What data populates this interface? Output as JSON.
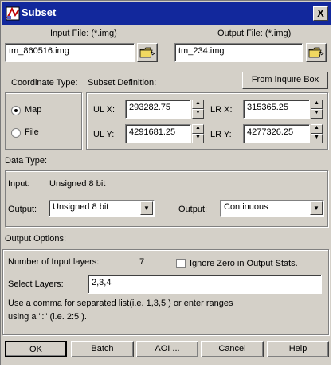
{
  "window": {
    "title": "Subset",
    "close_glyph": "X"
  },
  "files": {
    "input_label": "Input File: (*.img)",
    "input_value": "tm_860516.img",
    "output_label": "Output File: (*.img)",
    "output_value": "tm_234.img"
  },
  "coordinate": {
    "type_label": "Coordinate Type:",
    "options": [
      "Map",
      "File"
    ],
    "selected": "Map"
  },
  "subset": {
    "label": "Subset Definition:",
    "inquire_button": "From Inquire Box",
    "ulx_label": "UL X:",
    "ulx_value": "293282.75",
    "uly_label": "UL Y:",
    "uly_value": "4291681.25",
    "lrx_label": "LR X:",
    "lrx_value": "315365.25",
    "lry_label": "LR Y:",
    "lry_value": "4277326.25"
  },
  "data_type": {
    "label": "Data Type:",
    "input_label": "Input:",
    "input_value": "Unsigned 8 bit",
    "output_label": "Output:",
    "output_value": "Unsigned 8 bit",
    "output2_label": "Output:",
    "output2_value": "Continuous"
  },
  "options": {
    "label": "Output Options:",
    "num_layers_label": "Number of Input layers:",
    "num_layers_value": "7",
    "ignore_zero_label": "Ignore Zero in Output Stats.",
    "select_layers_label": "Select Layers:",
    "select_layers_value": "2,3,4",
    "hint_line1": "Use a comma for separated list(i.e. 1,3,5 ) or enter ranges",
    "hint_line2": "using a \":\" (i.e. 2:5 )."
  },
  "buttons": {
    "ok": "OK",
    "batch": "Batch",
    "aoi": "AOI ...",
    "cancel": "Cancel",
    "help": "Help"
  },
  "icons": {
    "app": "subset-app-icon",
    "folder": "open-folder-icon",
    "close": "close-icon",
    "spin": "spin-arrows-icon",
    "dropdown": "chevron-down-icon"
  }
}
